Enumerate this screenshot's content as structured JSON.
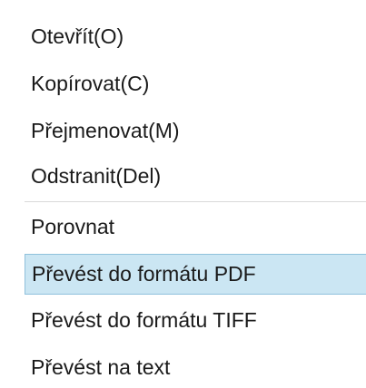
{
  "menu": {
    "items": [
      {
        "label": "Otevřít(O)"
      },
      {
        "label": "Kopírovat(C)"
      },
      {
        "label": "Přejmenovat(M)"
      },
      {
        "label": "Odstranit(Del)"
      },
      {
        "label": "Porovnat"
      },
      {
        "label": "Převést do formátu PDF",
        "highlighted": true
      },
      {
        "label": "Převést do formátu TIFF"
      },
      {
        "label": "Převést na text"
      }
    ]
  },
  "colors": {
    "highlight_background": "#cbe6f3",
    "highlight_border": "#8fc1dc",
    "separator": "#d9d9d9"
  }
}
